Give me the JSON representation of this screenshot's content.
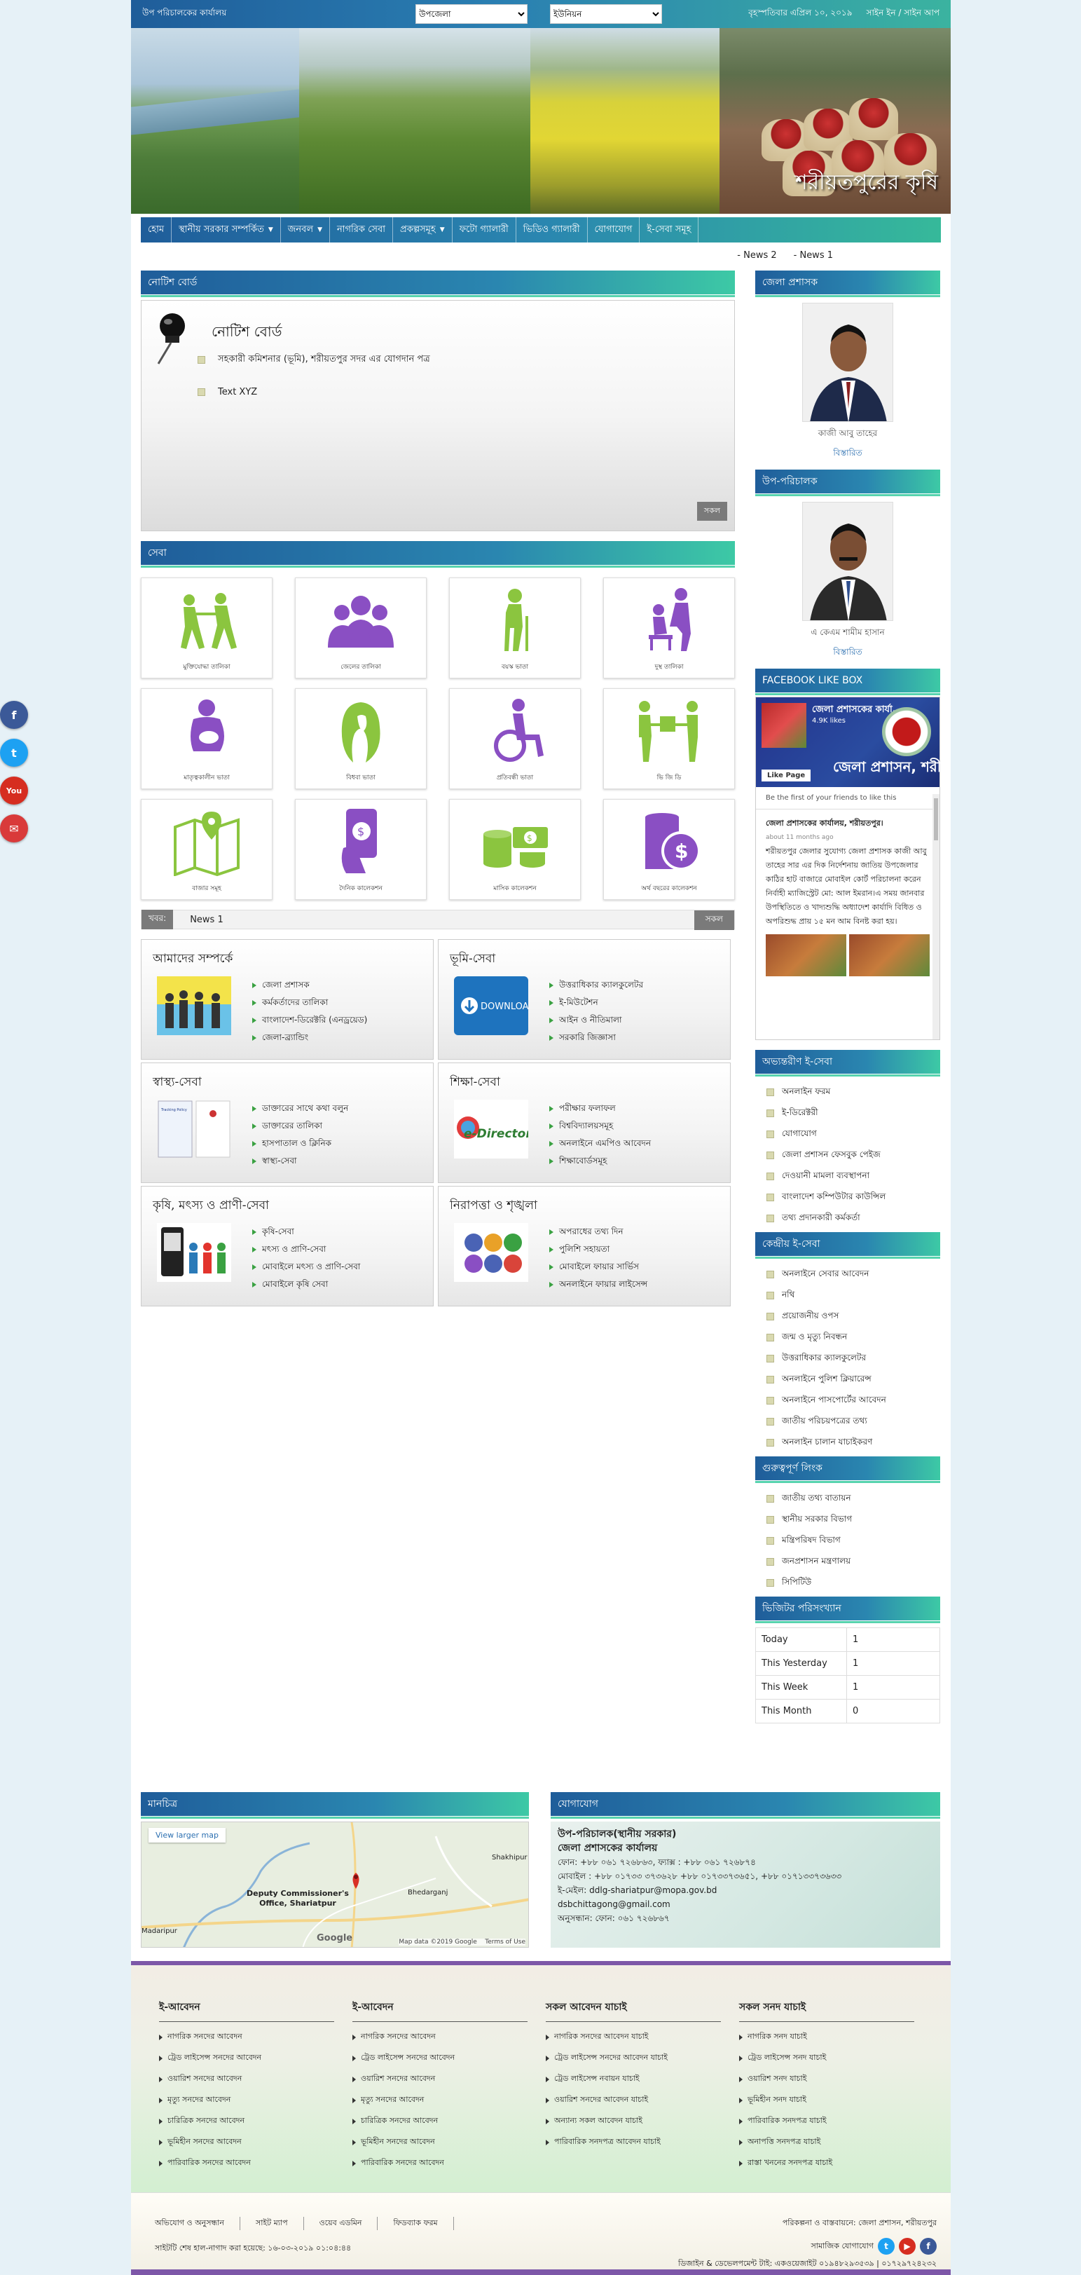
{
  "topbar": {
    "office": "উপ পরিচালকের কার্যালয়",
    "upazila_select": "উপজেলা",
    "union_select": "ইউনিয়ন",
    "date": "বৃহস্পতিবার এপ্রিল ১০, ২০১৯",
    "auth": "সাইন ইন / সাইন আপ"
  },
  "banner": {
    "caption": "শরীয়তপুরের কৃষি"
  },
  "nav": {
    "items": [
      {
        "label": "হোম",
        "dropdown": false
      },
      {
        "label": "স্থানীয় সরকার সম্পর্কিত",
        "dropdown": true
      },
      {
        "label": "জনবল",
        "dropdown": true
      },
      {
        "label": "নাগরিক সেবা",
        "dropdown": false
      },
      {
        "label": "প্রকল্পসমূহ",
        "dropdown": true
      },
      {
        "label": "ফটো গ্যালারী",
        "dropdown": false
      },
      {
        "label": "ভিডিও গ্যালারী",
        "dropdown": false
      },
      {
        "label": "যোগাযোগ",
        "dropdown": false
      },
      {
        "label": "ই-সেবা সমূহ",
        "dropdown": false
      }
    ]
  },
  "top_ticker": [
    "- News 2",
    "- News 1"
  ],
  "notice": {
    "header": "নোটিশ বোর্ড",
    "title": "নোটিশ বোর্ড",
    "items": [
      "সহকারী কমিশনার (ভূমি), শরীয়তপুর সদর এর যোগদান পত্র",
      "Text XYZ"
    ],
    "all_button": "সকল"
  },
  "services": {
    "header": "সেবা",
    "items": [
      {
        "label": "মুক্তিযোদ্ধা তালিকা",
        "icon": "freedom-fighter-icon",
        "color": "#8bc53f"
      },
      {
        "label": "জেলের তালিকা",
        "icon": "group-icon",
        "color": "#8a4fc3"
      },
      {
        "label": "বয়স্ক ভাতা",
        "icon": "elderly-icon",
        "color": "#8bc53f"
      },
      {
        "label": "দুস্থ তালিকা",
        "icon": "caregiver-icon",
        "color": "#8a4fc3"
      },
      {
        "label": "মাতৃত্বকালীন ভাতা",
        "icon": "pregnant-icon",
        "color": "#8a4fc3"
      },
      {
        "label": "বিধবা ভাতা",
        "icon": "widow-icon",
        "color": "#8bc53f"
      },
      {
        "label": "প্রতিবন্ধী ভাতা",
        "icon": "wheelchair-icon",
        "color": "#8a4fc3"
      },
      {
        "label": "ভি জি ডি",
        "icon": "handover-icon",
        "color": "#8bc53f"
      },
      {
        "label": "বাজার সমূহ",
        "icon": "map-icon",
        "color": "#8bc53f"
      },
      {
        "label": "দৈনিক কালেকশন",
        "icon": "mobile-payment-icon",
        "color": "#8a4fc3"
      },
      {
        "label": "মাসিক কালেকশন",
        "icon": "coins-icon",
        "color": "#8bc53f"
      },
      {
        "label": "অর্থ বছরের কালেকশন",
        "icon": "dollar-stack-icon",
        "color": "#8a4fc3"
      }
    ]
  },
  "news": {
    "key": "খবর:",
    "value": "News 1",
    "all": "সকল"
  },
  "boxes": [
    {
      "title": "আমাদের সম্পর্কে",
      "img": "people",
      "items": [
        "জেলা প্রশাসক",
        "কর্মকর্তাদের তালিকা",
        "বাংলাদেশ-ডিরেক্টরি (এনড্রয়েড)",
        "জেলা-ব্র্যান্ডিং"
      ]
    },
    {
      "title": "ভূমি-সেবা",
      "img": "download",
      "img_text": "DOWNLOAD",
      "items": [
        "উত্তরাধিকার ক্যালকুলেটর",
        "ই-মিউটেশন",
        "আইন ও নীতিমালা",
        "সরকারি জিজ্ঞাসা"
      ]
    },
    {
      "title": "স্বাস্থ্য-সেবা",
      "img": "doc",
      "img_text": "Tracking Policy",
      "items": [
        "ডাক্তারের সাথে কথা বলুন",
        "ডাক্তারের তালিকা",
        "হাসপাতাল ও ক্লিনিক",
        "স্বাস্থ্য-সেবা"
      ]
    },
    {
      "title": "শিক্ষা-সেবা",
      "img": "edirectory",
      "img_text": "e-Directory",
      "items": [
        "পরীক্ষার ফলাফল",
        "বিশ্ববিদ্যালয়সমূহ",
        "অনলাইনে এমপিও আবেদন",
        "শিক্ষাবোর্ডসমূহ"
      ]
    },
    {
      "title": "কৃষি, মৎস্য ও প্রাণী-সেবা",
      "img": "mobile",
      "items": [
        "কৃষি-সেবা",
        "মৎস্য ও প্রাণি-সেবা",
        "মোবাইলে মৎস্য ও প্রাণি-সেবা",
        "মোবাইলে কৃষি সেবা"
      ]
    },
    {
      "title": "নিরাপত্তা ও শৃঙ্খলা",
      "img": "security",
      "items": [
        "অপরাধের তথ্য দিন",
        "পুলিশি সহায়তা",
        "মোবাইলে ফায়ার সার্ভিস",
        "অনলাইনে ফায়ার লাইসেন্স"
      ]
    }
  ],
  "sidebar": {
    "dc": {
      "header": "জেলা প্রশাসক",
      "name": "কাজী আবু তাহের",
      "more": "বিস্তারিত"
    },
    "dd": {
      "header": "উপ-পরিচালক",
      "name": "এ কেএম শামীম হাসান",
      "more": "বিস্তারিত"
    },
    "fb": {
      "header": "FACEBOOK LIKE BOX",
      "page_name": "জেলা প্রশাসকের কার্যা...",
      "likes": "4.9K likes",
      "like_page": "Like Page",
      "banner_text": "জেলা প্রশাসন, শরীয়",
      "friends": "Be the first of your friends to like this",
      "post_title": "জেলা প্রশাসকের কার্যালয়, শরীয়তপুর।",
      "post_time": "about 11 months ago",
      "post_body": "শরীয়তপুর জেলার সুযোগ্য জেলা প্রশাসক কাজী আবু তাহের সার এর দিক নির্দেশনায় জাতিয় উপজেলার কাঠির হাট বাজারে মোবাইল কোর্ট পরিচালনা করেন নির্বাহী ম্যাজিস্ট্রেট মো: আল ইমরান।এ সময় জানবার উপস্থিতিতে ও খাদ্যশুদ্ধি অধ্যাদেশ কার্যাদি বিধিত ও অপরিশুদ্ধ প্রায় ১৫ মন আম বিনষ্ট করা হয়।"
    },
    "inner_eservice": {
      "header": "অভ্যন্তরীণ ই-সেবা",
      "items": [
        "অনলাইন ফরম",
        "ই-ডিরেক্টরী",
        "যোগাযোগ",
        "জেলা প্রশাসন ফেসবুক পেইজ",
        "দেওয়ানী মামলা ব্যবস্থাপনা",
        "বাংলাদেশ কম্পিউটার কাউন্সিল",
        "তথ্য প্রদানকারী কর্মকর্তা"
      ]
    },
    "central_eservice": {
      "header": "কেন্দ্রীয় ই-সেবা",
      "items": [
        "অনলাইনে সেবার আবেদন",
        "নথি",
        "প্রয়োজনীয় ওপস",
        "জন্ম ও মৃত্যু নিবন্ধন",
        "উত্তরাধিকার ক্যালকুলেটর",
        "অনলাইনে পুলিশ ক্লিয়ারেন্স",
        "অনলাইনে পাসপোর্টের আবেদন",
        "জাতীয় পরিচয়পত্রের তথ্য",
        "অনলাইন চালান যাচাইকরণ"
      ]
    },
    "important_links": {
      "header": "গুরুত্বপূর্ণ লিংক",
      "items": [
        "জাতীয় তথ্য বাতায়ন",
        "স্থানীয় সরকার বিভাগ",
        "মন্ত্রিপরিষদ বিভাগ",
        "জনপ্রশাসন মন্ত্রণালয়",
        "সিপিটিউ"
      ]
    },
    "visitors": {
      "header": "ভিজিটর পরিসংখ্যান",
      "rows": [
        {
          "k": "Today",
          "v": "1"
        },
        {
          "k": "This Yesterday",
          "v": "1"
        },
        {
          "k": "This Week",
          "v": "1"
        },
        {
          "k": "This Month",
          "v": "0"
        }
      ]
    }
  },
  "map": {
    "header": "মানচিত্র",
    "larger": "View larger map",
    "place": "Deputy Commissioner's\nOffice, Shariatpur",
    "labels": [
      "Shakhipur",
      "Bhedarganj",
      "Madaripur"
    ],
    "google": "Google",
    "footer": "Map data ©2019 Google    Terms of Use"
  },
  "contact": {
    "header": "যোগাযোগ",
    "line1": "উপ-পরিচালক(স্থানীয় সরকার)",
    "line2": "জেলা প্রশাসকের কার্যালয়",
    "phone": "ফোন: +৮৮ ০৬১ ৭২৬৮৬৩, ফ্যাক্স : +৮৮ ০৬১ ৭২৬৮৭৪",
    "mobile": "মোবাইল : +৮৮ ০১৭৩৩ ৩৭৩৬২৮ +৮৮ ০১৭৩৩৭৩৬৫১, +৮৮ ০১৭১৩৩৭৩৬৩৩",
    "email": "ই-মেইল: ddlg-shariatpur@mopa.gov.bd",
    "email2": "dsbchittagong@gmail.com",
    "enquiry": "অনুসন্ধান: ফোন: ০৬১ ৭২৬৮৬৭"
  },
  "footer": {
    "cols": [
      {
        "title": "ই-আবেদন",
        "items": [
          "নাগরিক সনদের আবেদন",
          "ট্রেড লাইসেন্স সনদের আবেদন",
          "ওয়ারিশ সনদের আবেদন",
          "মৃত্যু সনদের আবেদন",
          "চারিত্রিক সনদের আবেদন",
          "ভূমিহীন সনদের আবেদন",
          "পারিবারিক সনদের আবেদন"
        ]
      },
      {
        "title": "ই-আবেদন",
        "items": [
          "নাগরিক সনদের আবেদন",
          "ট্রেড লাইসেন্স সনদের আবেদন",
          "ওয়ারিশ সনদের আবেদন",
          "মৃত্যু সনদের আবেদন",
          "চারিত্রিক সনদের আবেদন",
          "ভূমিহীন সনদের আবেদন",
          "পারিবারিক সনদের আবেদন"
        ]
      },
      {
        "title": "সকল আবেদন যাচাই",
        "items": [
          "নাগরিক সনদের আবেদন যাচাই",
          "ট্রেড লাইসেন্স সনদের আবেদন যাচাই",
          "ট্রেড লাইসেন্স নবায়ন যাচাই",
          "ওয়ারিশ সনদের আবেদন যাচাই",
          "অন্যান্য সকল আবেদন যাচাই",
          "পারিবারিক সনদপত্র আবেদন যাচাই"
        ]
      },
      {
        "title": "সকল সনদ যাচাই",
        "items": [
          "নাগরিক সনদ যাচাই",
          "ট্রেড লাইসেন্স সনদ যাচাই",
          "ওয়ারিশ সনদ যাচাই",
          "ভূমিহীন সনদ যাচাই",
          "পারিবারিক সনদপত্র যাচাই",
          "অনাপত্তি সনদপত্র যাচাই",
          "রাস্তা খননের সনদপত্র যাচাই"
        ]
      }
    ],
    "links": [
      "অভিযোগ ও অনুসন্ধান",
      "সাইট ম্যাপ",
      "ওয়েব এডমিন",
      "ফিডব্যাক ফরম"
    ],
    "planning": "পরিকল্পনা ও বাস্তবায়নে: জেলা প্রশাসন, শরীয়তপুর",
    "updated": "সাইটটি শেষ হাল-নাগাদ করা হয়েছে: ১৬-০৩-২০১৯ ০১:০৪:৪৪",
    "social": "সামাজিক যোগাযোগ",
    "developer": "ডিজাইন & ডেভেলপমেন্ট টাই: একওয়েজাইট ০১৯৪৮২৯৩৫৩৯ | ০১৭২৯৭২৪২৩২"
  }
}
